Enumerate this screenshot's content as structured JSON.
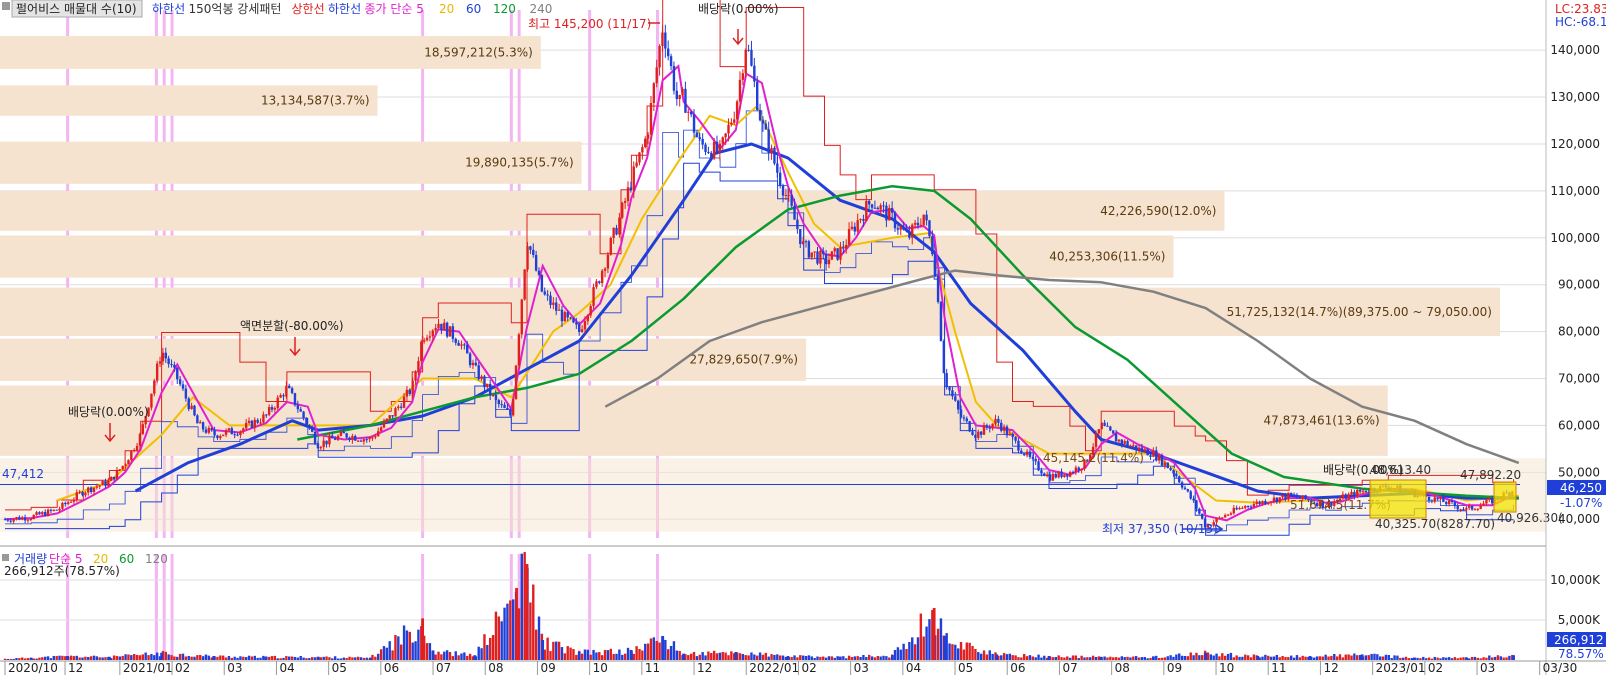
{
  "panel_title": {
    "name": "펄어비스 매물대 수(10)",
    "items": [
      {
        "text": "하한선",
        "color": "#1f3fd8"
      },
      {
        "text": "150억봉 강세패턴",
        "color": "#333333"
      },
      {
        "text": "상한선",
        "color": "#e02020"
      },
      {
        "text": "하한선",
        "color": "#1f3fd8"
      },
      {
        "text": "종가 단순 5",
        "color": "#e020d0"
      },
      {
        "text": "20",
        "color": "#e8b800"
      },
      {
        "text": "60",
        "color": "#1f3fd8"
      },
      {
        "text": "120",
        "color": "#0a9a30"
      },
      {
        "text": "240",
        "color": "#808080"
      }
    ]
  },
  "corner_labels": {
    "lc": "LC:23.83",
    "hc": "HC:-68.1"
  },
  "price_axis": {
    "ticks": [
      "140,000",
      "130,000",
      "120,000",
      "110,000",
      "100,000",
      "90,000",
      "80,000",
      "70,000",
      "60,000",
      "50,000",
      "40,000"
    ],
    "current_price": "46,250",
    "current_change": "-1.07%",
    "left_ref": "47,412"
  },
  "volume_panel": {
    "legend": [
      {
        "text": "거래량",
        "color": "#1f3fd8"
      },
      {
        "text": "단순 5",
        "color": "#e020d0"
      },
      {
        "text": "20",
        "color": "#e8b800"
      },
      {
        "text": "60",
        "color": "#0a9a30"
      },
      {
        "text": "120",
        "color": "#808080"
      }
    ],
    "summary": "266,912주(78.57%)",
    "ticks": [
      "10,000K",
      "5,000K"
    ],
    "current": "266,912",
    "current_pct": "78.57%"
  },
  "x_axis": {
    "labels": [
      "2020/10",
      "12",
      "2021/01",
      "02",
      "03",
      "04",
      "05",
      "06",
      "07",
      "08",
      "09",
      "10",
      "11",
      "12",
      "2022/01",
      "02",
      "03",
      "04",
      "05",
      "06",
      "07",
      "08",
      "09",
      "10",
      "11",
      "12",
      "2023/01",
      "02",
      "03",
      "03/30"
    ]
  },
  "annotations": {
    "high": "최고 145,200 (11/17)",
    "low": "최저 37,350 (10/13)",
    "dividend": "배당락(0.00%)",
    "split": "액면분할(-80.00%)",
    "box_low": "40,325.70(8287.70)",
    "box_high": "47,892.20",
    "right_low": "40,926.30(",
    "mid_label": "45,145,2(11.4%)",
    "mid_label2": "51,674.5(11.7%)",
    "box_top_label": "48,613.40"
  },
  "chart_data": {
    "type": "candlestick",
    "title": "펄어비스 매물대 수(10)",
    "ylim": [
      36000,
      146000
    ],
    "price_ticks": [
      140000,
      130000,
      120000,
      110000,
      100000,
      90000,
      80000,
      70000,
      60000,
      50000,
      40000
    ],
    "price_series": [
      {
        "m": 0,
        "v": 40000
      },
      {
        "m": 0.5,
        "v": 40500
      },
      {
        "m": 1,
        "v": 42000
      },
      {
        "m": 1.5,
        "v": 46000
      },
      {
        "m": 2,
        "v": 48000
      },
      {
        "m": 2.3,
        "v": 52000
      },
      {
        "m": 2.6,
        "v": 58000
      },
      {
        "m": 3,
        "v": 76000
      },
      {
        "m": 3.3,
        "v": 70000
      },
      {
        "m": 3.7,
        "v": 60000
      },
      {
        "m": 4,
        "v": 58000
      },
      {
        "m": 4.5,
        "v": 59000
      },
      {
        "m": 5,
        "v": 62000
      },
      {
        "m": 5.4,
        "v": 68000
      },
      {
        "m": 5.8,
        "v": 60000
      },
      {
        "m": 6,
        "v": 56000
      },
      {
        "m": 6.5,
        "v": 58000
      },
      {
        "m": 7,
        "v": 57000
      },
      {
        "m": 7.4,
        "v": 62000
      },
      {
        "m": 7.8,
        "v": 68000
      },
      {
        "m": 8,
        "v": 79000
      },
      {
        "m": 8.3,
        "v": 82000
      },
      {
        "m": 8.7,
        "v": 78000
      },
      {
        "m": 9,
        "v": 72000
      },
      {
        "m": 9.4,
        "v": 65000
      },
      {
        "m": 9.7,
        "v": 62000
      },
      {
        "m": 10,
        "v": 100000
      },
      {
        "m": 10.3,
        "v": 88000
      },
      {
        "m": 10.7,
        "v": 83000
      },
      {
        "m": 11,
        "v": 80000
      },
      {
        "m": 11.4,
        "v": 92000
      },
      {
        "m": 11.8,
        "v": 105000
      },
      {
        "m": 12,
        "v": 112000
      },
      {
        "m": 12.3,
        "v": 122000
      },
      {
        "m": 12.6,
        "v": 145200
      },
      {
        "m": 12.9,
        "v": 128000
      },
      {
        "m": 13,
        "v": 130000
      },
      {
        "m": 13.3,
        "v": 120000
      },
      {
        "m": 13.7,
        "v": 118000
      },
      {
        "m": 14,
        "v": 128000
      },
      {
        "m": 14.2,
        "v": 142000
      },
      {
        "m": 14.5,
        "v": 124000
      },
      {
        "m": 14.8,
        "v": 114000
      },
      {
        "m": 15,
        "v": 108000
      },
      {
        "m": 15.3,
        "v": 98000
      },
      {
        "m": 15.7,
        "v": 95000
      },
      {
        "m": 16,
        "v": 97000
      },
      {
        "m": 16.3,
        "v": 103000
      },
      {
        "m": 16.6,
        "v": 108000
      },
      {
        "m": 17,
        "v": 104000
      },
      {
        "m": 17.3,
        "v": 100000
      },
      {
        "m": 17.6,
        "v": 105000
      },
      {
        "m": 17.8,
        "v": 96000
      },
      {
        "m": 18,
        "v": 70000
      },
      {
        "m": 18.3,
        "v": 62000
      },
      {
        "m": 18.6,
        "v": 58000
      },
      {
        "m": 19,
        "v": 61000
      },
      {
        "m": 19.3,
        "v": 57000
      },
      {
        "m": 19.7,
        "v": 52000
      },
      {
        "m": 20,
        "v": 49000
      },
      {
        "m": 20.4,
        "v": 50000
      },
      {
        "m": 20.7,
        "v": 52000
      },
      {
        "m": 21,
        "v": 60000
      },
      {
        "m": 21.3,
        "v": 57000
      },
      {
        "m": 21.7,
        "v": 55000
      },
      {
        "m": 22,
        "v": 54000
      },
      {
        "m": 22.4,
        "v": 50000
      },
      {
        "m": 22.8,
        "v": 43000
      },
      {
        "m": 23,
        "v": 38500
      },
      {
        "m": 23.4,
        "v": 41000
      },
      {
        "m": 23.8,
        "v": 43000
      },
      {
        "m": 24.2,
        "v": 44000
      },
      {
        "m": 24.6,
        "v": 45000
      },
      {
        "m": 25,
        "v": 44000
      },
      {
        "m": 25.3,
        "v": 43000
      },
      {
        "m": 25.6,
        "v": 44500
      },
      {
        "m": 26,
        "v": 46000
      },
      {
        "m": 26.5,
        "v": 47000
      },
      {
        "m": 27,
        "v": 45500
      },
      {
        "m": 27.5,
        "v": 44000
      },
      {
        "m": 28,
        "v": 42000
      },
      {
        "m": 28.5,
        "v": 44000
      },
      {
        "m": 28.9,
        "v": 46250
      }
    ],
    "lines": [
      {
        "name": "20",
        "color": "#f0c000",
        "width": 2,
        "points": [
          [
            1,
            44000
          ],
          [
            2,
            48000
          ],
          [
            3,
            58000
          ],
          [
            3.6,
            66000
          ],
          [
            4.3,
            60000
          ],
          [
            5,
            60000
          ],
          [
            6,
            60000
          ],
          [
            7,
            60000
          ],
          [
            8,
            70000
          ],
          [
            9,
            70000
          ],
          [
            9.7,
            66000
          ],
          [
            10.5,
            80000
          ],
          [
            11,
            84000
          ],
          [
            11.6,
            90000
          ],
          [
            12.2,
            104000
          ],
          [
            13,
            118000
          ],
          [
            13.5,
            126000
          ],
          [
            14,
            124000
          ],
          [
            14.4,
            128000
          ],
          [
            15,
            114000
          ],
          [
            15.5,
            103000
          ],
          [
            16,
            98000
          ],
          [
            17,
            100000
          ],
          [
            17.7,
            101000
          ],
          [
            18.2,
            80000
          ],
          [
            18.6,
            65000
          ],
          [
            19,
            60000
          ],
          [
            20,
            54000
          ],
          [
            21,
            54000
          ],
          [
            22,
            54000
          ],
          [
            22.6,
            49000
          ],
          [
            23.2,
            44000
          ],
          [
            24,
            43500
          ],
          [
            25,
            44000
          ],
          [
            26,
            45500
          ],
          [
            27,
            46500
          ],
          [
            28,
            44000
          ],
          [
            29,
            45000
          ]
        ]
      },
      {
        "name": "60",
        "color": "#1f3fd8",
        "width": 3,
        "points": [
          [
            2.5,
            46000
          ],
          [
            3.5,
            52000
          ],
          [
            4.5,
            56000
          ],
          [
            5.5,
            61000
          ],
          [
            6,
            59000
          ],
          [
            7,
            60000
          ],
          [
            8,
            62000
          ],
          [
            9,
            66000
          ],
          [
            10,
            72000
          ],
          [
            11,
            78000
          ],
          [
            12,
            92000
          ],
          [
            13,
            108000
          ],
          [
            13.6,
            118000
          ],
          [
            14.3,
            120000
          ],
          [
            15,
            117000
          ],
          [
            16,
            108000
          ],
          [
            17,
            104000
          ],
          [
            17.8,
            97000
          ],
          [
            18.5,
            86000
          ],
          [
            19.5,
            76000
          ],
          [
            20.5,
            63000
          ],
          [
            21,
            57000
          ],
          [
            22,
            54000
          ],
          [
            23,
            50000
          ],
          [
            24,
            46000
          ],
          [
            25,
            44500
          ],
          [
            26,
            45000
          ],
          [
            27,
            45500
          ],
          [
            28,
            44500
          ],
          [
            29,
            44500
          ]
        ]
      },
      {
        "name": "120",
        "color": "#0a9a30",
        "width": 2.5,
        "points": [
          [
            5.6,
            57000
          ],
          [
            7,
            60000
          ],
          [
            8,
            63000
          ],
          [
            9,
            66000
          ],
          [
            10,
            68000
          ],
          [
            11,
            71000
          ],
          [
            12,
            78000
          ],
          [
            13,
            87000
          ],
          [
            14,
            98000
          ],
          [
            15,
            106000
          ],
          [
            16,
            109000
          ],
          [
            17,
            111000
          ],
          [
            17.8,
            110000
          ],
          [
            18.5,
            104000
          ],
          [
            19.5,
            92000
          ],
          [
            20.5,
            81000
          ],
          [
            21.5,
            74000
          ],
          [
            22.5,
            64000
          ],
          [
            23.5,
            54000
          ],
          [
            24.5,
            49000
          ],
          [
            26,
            46500
          ],
          [
            28,
            45000
          ],
          [
            29,
            44500
          ]
        ]
      },
      {
        "name": "240",
        "color": "#808080",
        "width": 2.5,
        "points": [
          [
            11.5,
            64000
          ],
          [
            12.5,
            70000
          ],
          [
            13.5,
            78000
          ],
          [
            14.5,
            82000
          ],
          [
            15.5,
            85000
          ],
          [
            16.5,
            88000
          ],
          [
            17.5,
            91000
          ],
          [
            18.2,
            93000
          ],
          [
            19,
            92000
          ],
          [
            20,
            91000
          ],
          [
            21,
            90500
          ],
          [
            22,
            88500
          ],
          [
            23,
            85000
          ],
          [
            24,
            78000
          ],
          [
            25,
            70000
          ],
          [
            26,
            64000
          ],
          [
            27,
            61000
          ],
          [
            28,
            56000
          ],
          [
            29,
            52000
          ]
        ]
      }
    ],
    "volume_profile": [
      {
        "label": "18,597,212(5.3%)",
        "price_low": 136000,
        "price_high": 143000,
        "pct": 5.3
      },
      {
        "label": "13,134,587(3.7%)",
        "price_low": 126000,
        "price_high": 132500,
        "pct": 3.7
      },
      {
        "label": "19,890,135(5.7%)",
        "price_low": 111500,
        "price_high": 120500,
        "pct": 5.7
      },
      {
        "label": "42,226,590(12.0%)",
        "price_low": 101500,
        "price_high": 110000,
        "pct": 12.0
      },
      {
        "label": "40,253,306(11.5%)",
        "price_low": 91500,
        "price_high": 100500,
        "pct": 11.5
      },
      {
        "label": "51,725,132(14.7%)(89,375.00 ~ 79,050.00)",
        "price_low": 79050,
        "price_high": 89375,
        "pct": 14.7
      },
      {
        "label": "27,829,650(7.9%)",
        "price_low": 69500,
        "price_high": 78500,
        "pct": 7.9
      },
      {
        "label": "47,873,461(13.6%)",
        "price_low": 53500,
        "price_high": 68500,
        "pct": 13.6
      }
    ],
    "volume_series": [
      {
        "m": 0.5,
        "v": 300
      },
      {
        "m": 1.2,
        "v": 500
      },
      {
        "m": 2,
        "v": 400
      },
      {
        "m": 3,
        "v": 900
      },
      {
        "m": 4,
        "v": 500
      },
      {
        "m": 5,
        "v": 400
      },
      {
        "m": 6,
        "v": 400
      },
      {
        "m": 7,
        "v": 300
      },
      {
        "m": 8,
        "v": 5200
      },
      {
        "m": 8.2,
        "v": 1200
      },
      {
        "m": 9,
        "v": 600
      },
      {
        "m": 9.8,
        "v": 9000
      },
      {
        "m": 10,
        "v": 12000
      },
      {
        "m": 10.3,
        "v": 2500
      },
      {
        "m": 11,
        "v": 1000
      },
      {
        "m": 12,
        "v": 1200
      },
      {
        "m": 12.6,
        "v": 3000
      },
      {
        "m": 13,
        "v": 800
      },
      {
        "m": 14,
        "v": 1000
      },
      {
        "m": 15,
        "v": 500
      },
      {
        "m": 16,
        "v": 400
      },
      {
        "m": 17,
        "v": 600
      },
      {
        "m": 17.8,
        "v": 6500
      },
      {
        "m": 18,
        "v": 3000
      },
      {
        "m": 19,
        "v": 700
      },
      {
        "m": 20,
        "v": 500
      },
      {
        "m": 21,
        "v": 400
      },
      {
        "m": 22,
        "v": 400
      },
      {
        "m": 23,
        "v": 900
      },
      {
        "m": 24,
        "v": 500
      },
      {
        "m": 25,
        "v": 500
      },
      {
        "m": 26,
        "v": 700
      },
      {
        "m": 27,
        "v": 300
      },
      {
        "m": 28,
        "v": 300
      },
      {
        "m": 28.9,
        "v": 600
      }
    ],
    "volume_ylim": [
      0,
      12500
    ],
    "volume_ticks": [
      10000,
      5000
    ],
    "highlight_months": [
      1.2,
      2.9,
      3.05,
      3.2,
      8,
      9.7,
      9.85,
      11.2,
      12.5
    ],
    "current_price_line": 47412
  }
}
